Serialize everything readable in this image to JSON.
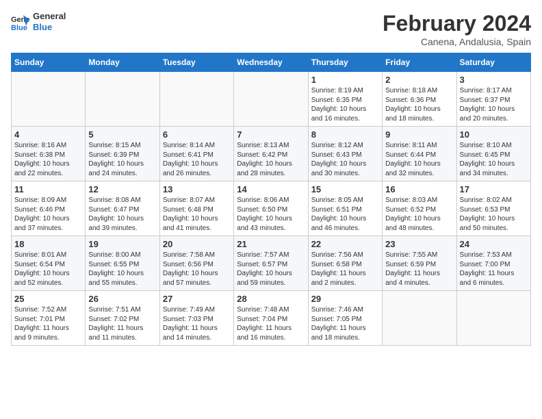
{
  "logo": {
    "line1": "General",
    "line2": "Blue"
  },
  "title": "February 2024",
  "location": "Canena, Andalusia, Spain",
  "weekdays": [
    "Sunday",
    "Monday",
    "Tuesday",
    "Wednesday",
    "Thursday",
    "Friday",
    "Saturday"
  ],
  "weeks": [
    [
      {
        "day": "",
        "content": ""
      },
      {
        "day": "",
        "content": ""
      },
      {
        "day": "",
        "content": ""
      },
      {
        "day": "",
        "content": ""
      },
      {
        "day": "1",
        "content": "Sunrise: 8:19 AM\nSunset: 6:35 PM\nDaylight: 10 hours\nand 16 minutes."
      },
      {
        "day": "2",
        "content": "Sunrise: 8:18 AM\nSunset: 6:36 PM\nDaylight: 10 hours\nand 18 minutes."
      },
      {
        "day": "3",
        "content": "Sunrise: 8:17 AM\nSunset: 6:37 PM\nDaylight: 10 hours\nand 20 minutes."
      }
    ],
    [
      {
        "day": "4",
        "content": "Sunrise: 8:16 AM\nSunset: 6:38 PM\nDaylight: 10 hours\nand 22 minutes."
      },
      {
        "day": "5",
        "content": "Sunrise: 8:15 AM\nSunset: 6:39 PM\nDaylight: 10 hours\nand 24 minutes."
      },
      {
        "day": "6",
        "content": "Sunrise: 8:14 AM\nSunset: 6:41 PM\nDaylight: 10 hours\nand 26 minutes."
      },
      {
        "day": "7",
        "content": "Sunrise: 8:13 AM\nSunset: 6:42 PM\nDaylight: 10 hours\nand 28 minutes."
      },
      {
        "day": "8",
        "content": "Sunrise: 8:12 AM\nSunset: 6:43 PM\nDaylight: 10 hours\nand 30 minutes."
      },
      {
        "day": "9",
        "content": "Sunrise: 8:11 AM\nSunset: 6:44 PM\nDaylight: 10 hours\nand 32 minutes."
      },
      {
        "day": "10",
        "content": "Sunrise: 8:10 AM\nSunset: 6:45 PM\nDaylight: 10 hours\nand 34 minutes."
      }
    ],
    [
      {
        "day": "11",
        "content": "Sunrise: 8:09 AM\nSunset: 6:46 PM\nDaylight: 10 hours\nand 37 minutes."
      },
      {
        "day": "12",
        "content": "Sunrise: 8:08 AM\nSunset: 6:47 PM\nDaylight: 10 hours\nand 39 minutes."
      },
      {
        "day": "13",
        "content": "Sunrise: 8:07 AM\nSunset: 6:48 PM\nDaylight: 10 hours\nand 41 minutes."
      },
      {
        "day": "14",
        "content": "Sunrise: 8:06 AM\nSunset: 6:50 PM\nDaylight: 10 hours\nand 43 minutes."
      },
      {
        "day": "15",
        "content": "Sunrise: 8:05 AM\nSunset: 6:51 PM\nDaylight: 10 hours\nand 46 minutes."
      },
      {
        "day": "16",
        "content": "Sunrise: 8:03 AM\nSunset: 6:52 PM\nDaylight: 10 hours\nand 48 minutes."
      },
      {
        "day": "17",
        "content": "Sunrise: 8:02 AM\nSunset: 6:53 PM\nDaylight: 10 hours\nand 50 minutes."
      }
    ],
    [
      {
        "day": "18",
        "content": "Sunrise: 8:01 AM\nSunset: 6:54 PM\nDaylight: 10 hours\nand 52 minutes."
      },
      {
        "day": "19",
        "content": "Sunrise: 8:00 AM\nSunset: 6:55 PM\nDaylight: 10 hours\nand 55 minutes."
      },
      {
        "day": "20",
        "content": "Sunrise: 7:58 AM\nSunset: 6:56 PM\nDaylight: 10 hours\nand 57 minutes."
      },
      {
        "day": "21",
        "content": "Sunrise: 7:57 AM\nSunset: 6:57 PM\nDaylight: 10 hours\nand 59 minutes."
      },
      {
        "day": "22",
        "content": "Sunrise: 7:56 AM\nSunset: 6:58 PM\nDaylight: 11 hours\nand 2 minutes."
      },
      {
        "day": "23",
        "content": "Sunrise: 7:55 AM\nSunset: 6:59 PM\nDaylight: 11 hours\nand 4 minutes."
      },
      {
        "day": "24",
        "content": "Sunrise: 7:53 AM\nSunset: 7:00 PM\nDaylight: 11 hours\nand 6 minutes."
      }
    ],
    [
      {
        "day": "25",
        "content": "Sunrise: 7:52 AM\nSunset: 7:01 PM\nDaylight: 11 hours\nand 9 minutes."
      },
      {
        "day": "26",
        "content": "Sunrise: 7:51 AM\nSunset: 7:02 PM\nDaylight: 11 hours\nand 11 minutes."
      },
      {
        "day": "27",
        "content": "Sunrise: 7:49 AM\nSunset: 7:03 PM\nDaylight: 11 hours\nand 14 minutes."
      },
      {
        "day": "28",
        "content": "Sunrise: 7:48 AM\nSunset: 7:04 PM\nDaylight: 11 hours\nand 16 minutes."
      },
      {
        "day": "29",
        "content": "Sunrise: 7:46 AM\nSunset: 7:05 PM\nDaylight: 11 hours\nand 18 minutes."
      },
      {
        "day": "",
        "content": ""
      },
      {
        "day": "",
        "content": ""
      }
    ]
  ]
}
